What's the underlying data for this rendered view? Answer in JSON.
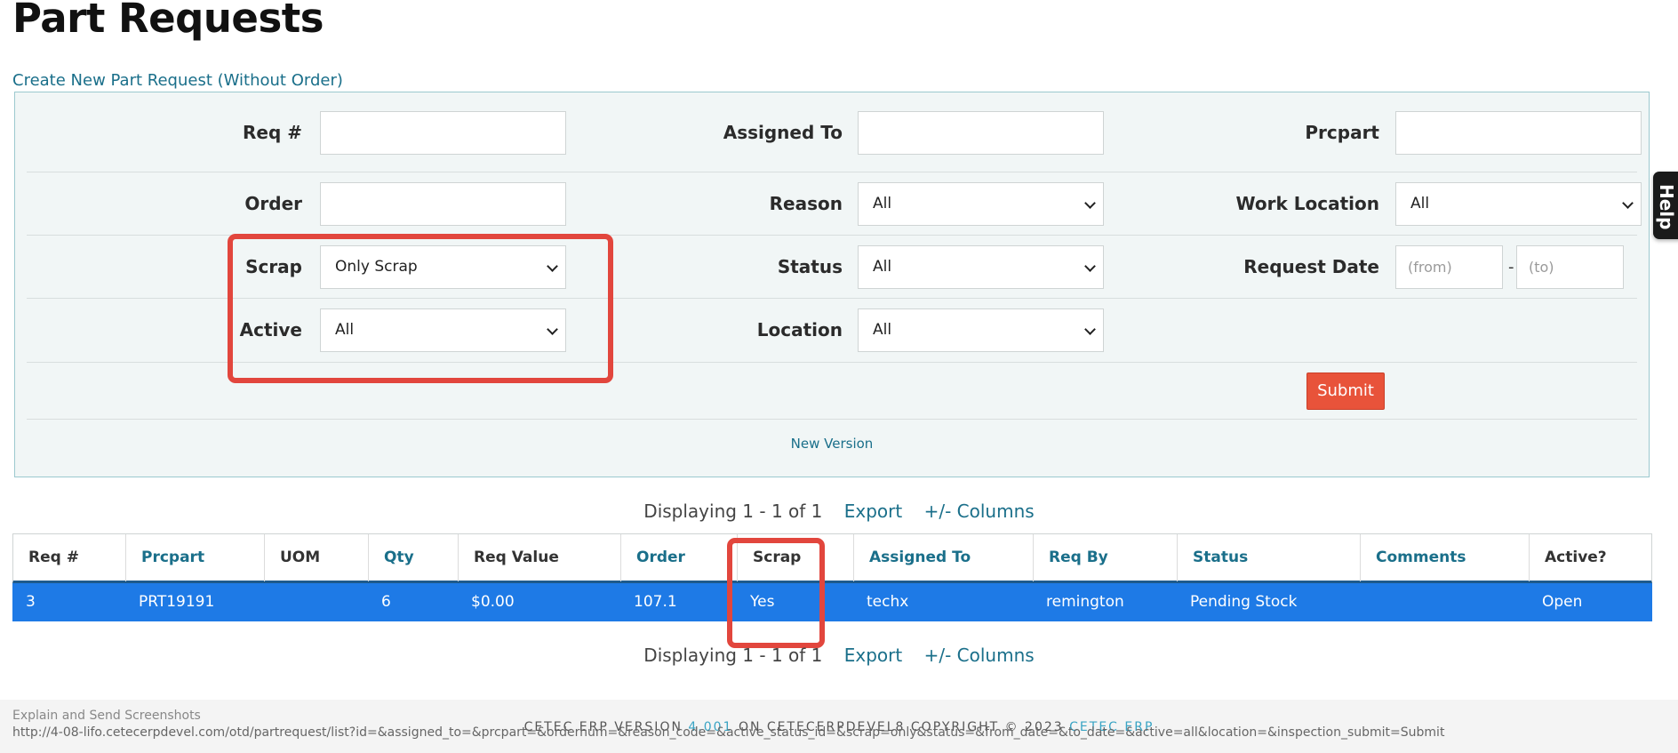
{
  "page": {
    "title": "Part Requests",
    "create_link": "Create New Part Request (Without Order)"
  },
  "filters": {
    "req_label": "Req #",
    "req_value": "",
    "assigned_label": "Assigned To",
    "assigned_value": "",
    "prcpart_label": "Prcpart",
    "prcpart_value": "",
    "order_label": "Order",
    "order_value": "",
    "reason_label": "Reason",
    "reason_value": "All",
    "work_location_label": "Work Location",
    "work_location_value": "All",
    "scrap_label": "Scrap",
    "scrap_value": "Only Scrap",
    "status_label": "Status",
    "status_value": "All",
    "request_date_label": "Request Date",
    "date_from_placeholder": "(from)",
    "date_to_placeholder": "(to)",
    "date_separator": "-",
    "active_label": "Active",
    "active_value": "All",
    "location_label": "Location",
    "location_value": "All",
    "submit_label": "Submit",
    "new_version_label": "New Version"
  },
  "pager": {
    "text": "Displaying 1 - 1 of 1",
    "export_label": "Export",
    "columns_label": "+/- Columns"
  },
  "table": {
    "headers": [
      "Req #",
      "Prcpart",
      "UOM",
      "Qty",
      "Req Value",
      "Order",
      "Scrap",
      "Assigned To",
      "Req By",
      "Status",
      "Comments",
      "Active?"
    ],
    "rows": [
      [
        "3",
        "PRT19191",
        "",
        "6",
        "$0.00",
        "107.1",
        "Yes",
        "techx",
        "remington",
        "Pending Stock",
        "",
        "Open"
      ]
    ]
  },
  "footer": {
    "brand_left": "CETEC ERP VERSION",
    "version": "4.001",
    "brand_mid": "ON CETECERPDEVEL8   COPYRIGHT © 2023",
    "brand_right": "CETEC ERP",
    "explain": "Explain and Send Screenshots",
    "status_url": "http://4-08-lifo.cetecerpdevel.com/otd/partrequest/list?id=&assigned_to=&prcpart=&ordernum=&reason_code=&active_status_id=&scrap=only&status=&from_date=&to_date=&active=all&location=&inspection_submit=Submit"
  },
  "help_tab": {
    "label": "Help"
  },
  "colors": {
    "link": "#1a6f8a",
    "submit": "#e8533a",
    "selected_row": "#1e7ae6",
    "highlight": "#e2463d",
    "panel_bg": "#f1f6f6"
  }
}
